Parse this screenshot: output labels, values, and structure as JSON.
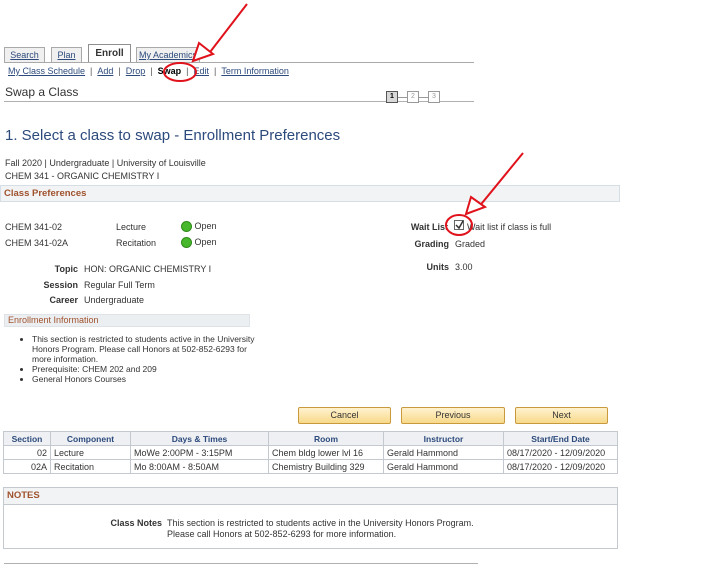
{
  "tabs": [
    {
      "label": "Search"
    },
    {
      "label": "Plan"
    },
    {
      "label": "Enroll"
    },
    {
      "label": "My Academics"
    }
  ],
  "subnav": {
    "my_class_schedule": "My Class Schedule",
    "add": "Add",
    "drop": "Drop",
    "swap": "Swap",
    "edit": "Edit",
    "term_information": "Term Information",
    "separator": "|"
  },
  "page_title": "Swap a Class",
  "steps": [
    "1",
    "2",
    "3"
  ],
  "heading": "1.  Select a class to swap - Enrollment Preferences",
  "term_line": "Fall 2020 | Undergraduate | University of Louisville",
  "course_line": "CHEM  341 - ORGANIC CHEMISTRY I",
  "class_preferences": {
    "title": "Class Preferences",
    "rows": [
      {
        "section": "CHEM  341-02",
        "component": "Lecture",
        "status": "Open"
      },
      {
        "section": "CHEM  341-02A",
        "component": "Recitation",
        "status": "Open"
      }
    ],
    "topic_label": "Topic",
    "topic": "HON: ORGANIC CHEMISTRY I",
    "session_label": "Session",
    "session": "Regular Full Term",
    "career_label": "Career",
    "career": "Undergraduate",
    "wait_list_label": "Wait List",
    "wait_list_text": "Wait list if class is full",
    "grading_label": "Grading",
    "grading": "Graded",
    "units_label": "Units",
    "units": "3.00"
  },
  "enrollment_information": {
    "title": "Enrollment Information",
    "items": [
      "This section is restricted to students active in the University Honors Program. Please call Honors at 502-852-6293 for more information.",
      "Prerequisite: CHEM 202 and 209",
      "General Honors Courses"
    ]
  },
  "buttons": {
    "cancel": "Cancel",
    "previous": "Previous",
    "next": "Next"
  },
  "schedule_table": {
    "headers": [
      "Section",
      "Component",
      "Days & Times",
      "Room",
      "Instructor",
      "Start/End Date"
    ],
    "rows": [
      [
        "02",
        "Lecture",
        "MoWe 2:00PM - 3:15PM",
        "Chem bldg lower lvl 16",
        "Gerald Hammond",
        "08/17/2020 - 12/09/2020"
      ],
      [
        "02A",
        "Recitation",
        "Mo 8:00AM - 8:50AM",
        "Chemistry Building 329",
        "Gerald Hammond",
        "08/17/2020 - 12/09/2020"
      ]
    ]
  },
  "notes": {
    "title": "NOTES",
    "class_notes_label": "Class Notes",
    "line1": "This section is restricted to students active in the University Honors Program.",
    "line2": "Please call Honors at 502-852-6293 for more information."
  },
  "colors": {
    "link": "#2c4a7c",
    "section_title": "#a0522d",
    "status_open": "#47b82b",
    "annotation": "#e0121b"
  }
}
